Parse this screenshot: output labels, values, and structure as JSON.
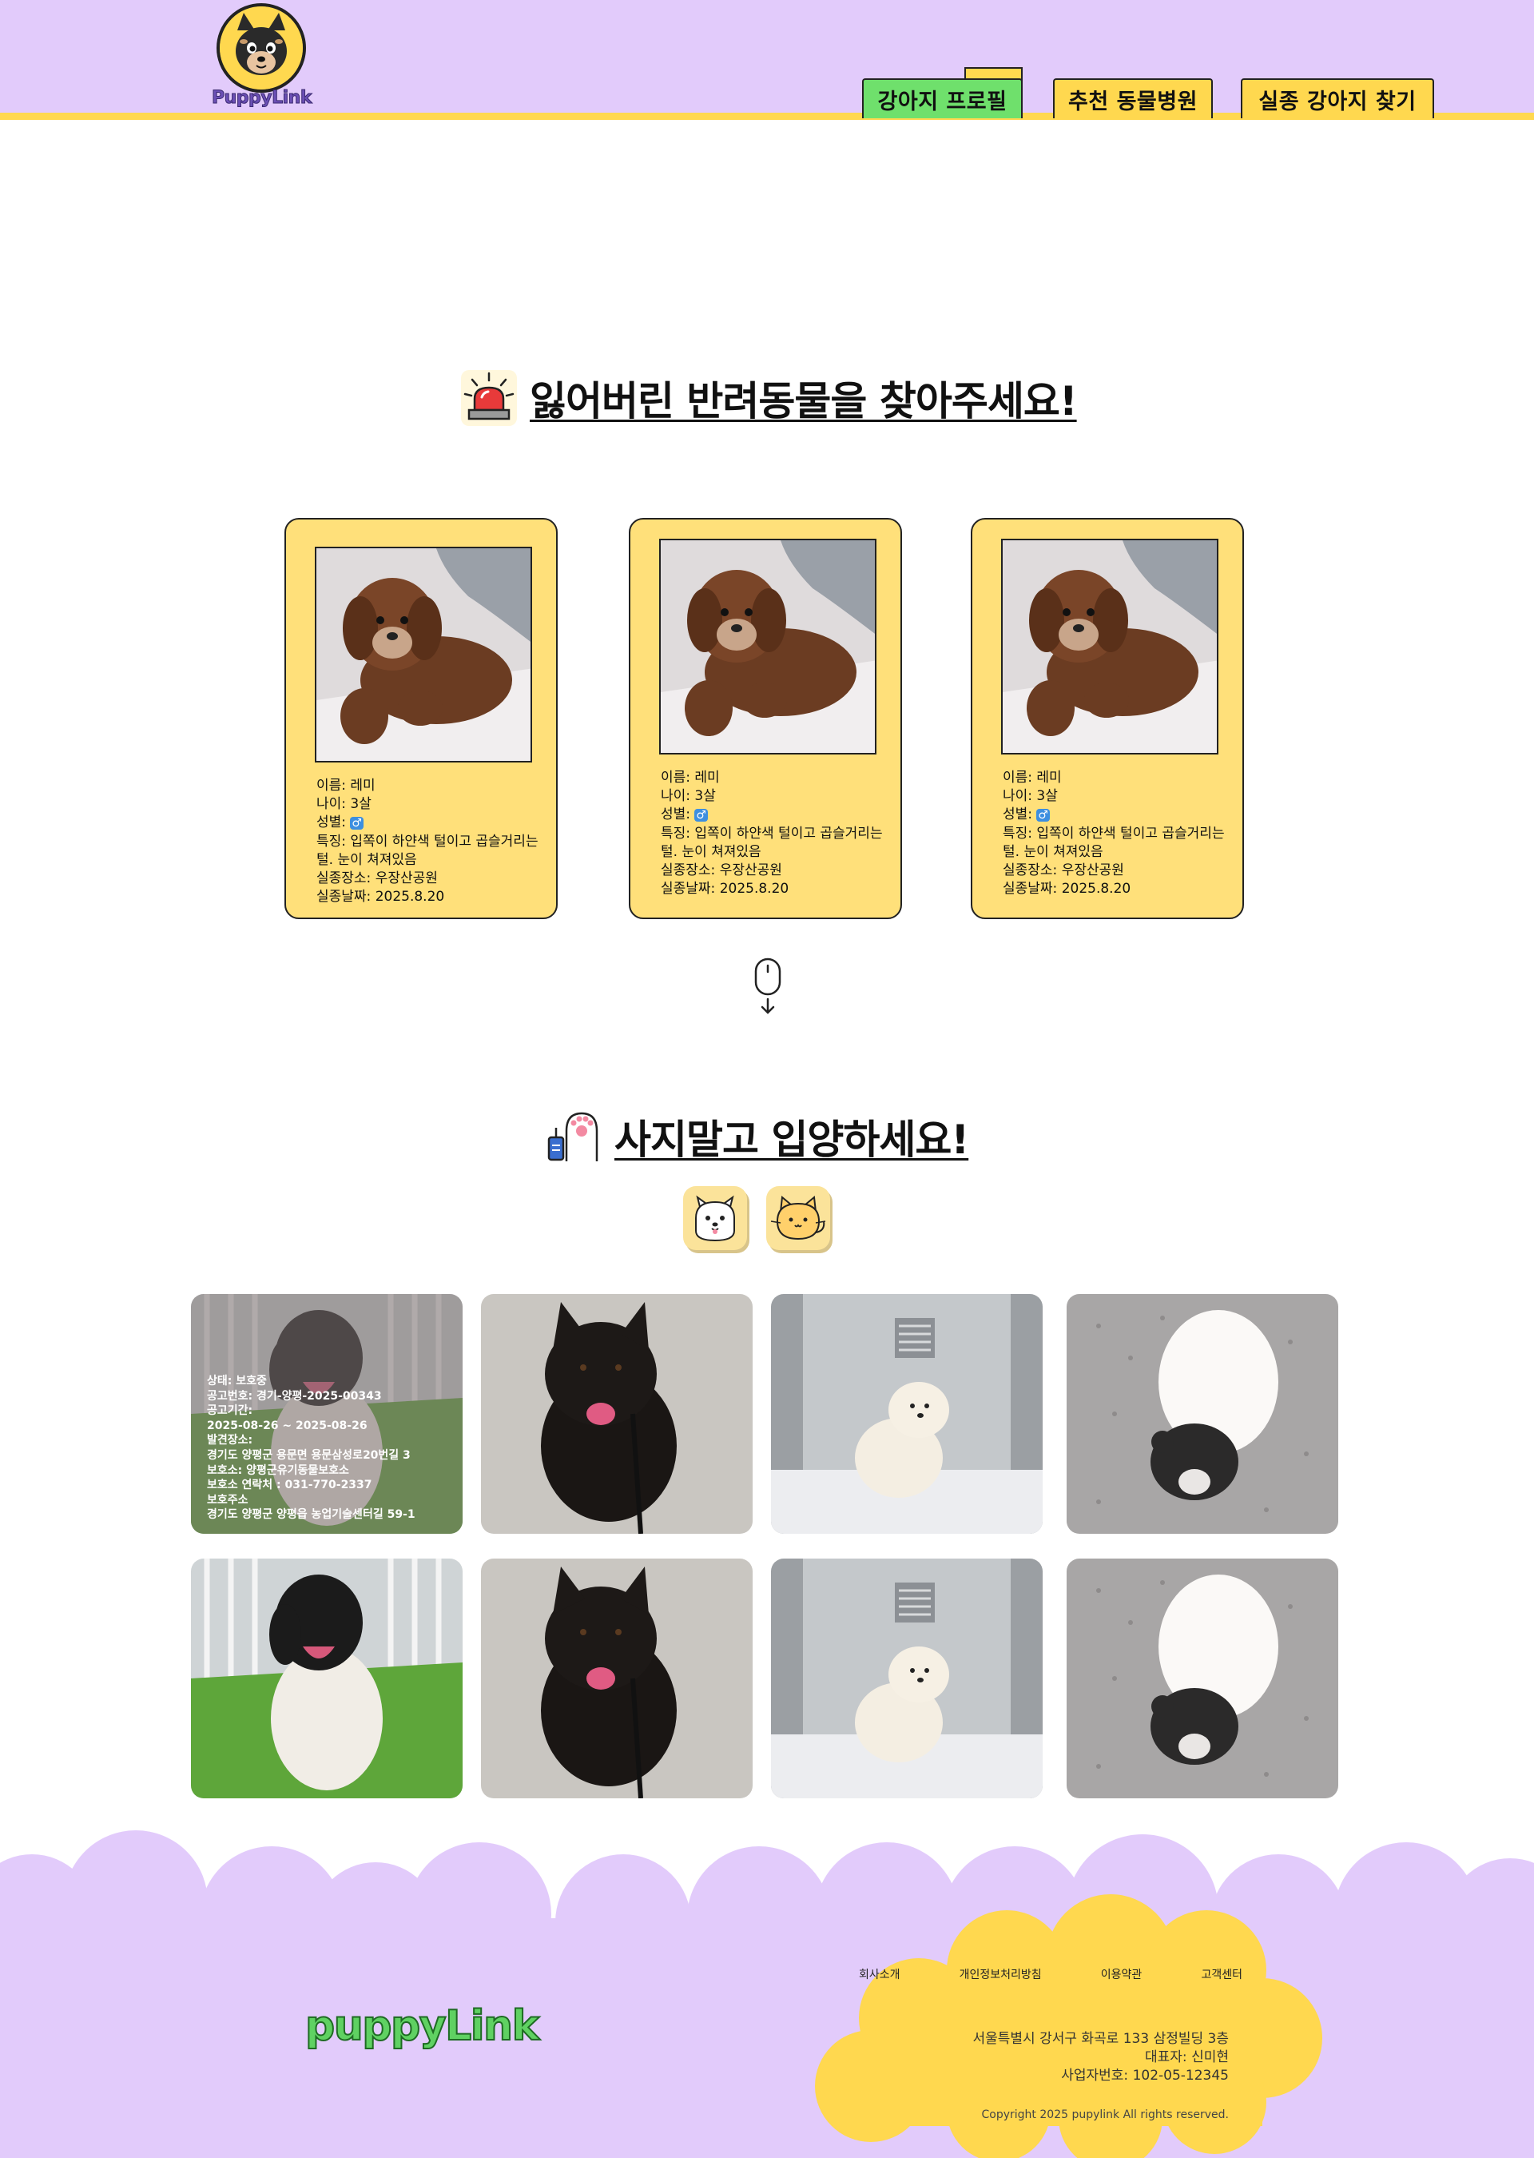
{
  "header": {
    "brand": "PuppyLink",
    "nav": [
      {
        "label": "강아지 프로필"
      },
      {
        "label": "추천 동물병원"
      },
      {
        "label": "실종 강아지 찾기"
      }
    ]
  },
  "missing": {
    "title": "잃어버린 반려동물을 찾아주세요!",
    "cards": [
      {
        "name": "이름: 레미",
        "age": "나이: 3살",
        "gender_label": "성별: ",
        "gender_symbol": "♂",
        "feature": "특징: 입쪽이 하얀색 털이고 곱슬거리는 털. 눈이 쳐져있음",
        "place": "실종장소: 우장산공원",
        "date": "실종날짜: 2025.8.20"
      },
      {
        "name": "이름: 레미",
        "age": "나이: 3살",
        "gender_label": "성별: ",
        "gender_symbol": "♂",
        "feature": "특징: 입쪽이 하얀색 털이고 곱슬거리는 털. 눈이 쳐져있음",
        "place": "실종장소: 우장산공원",
        "date": "실종날짜: 2025.8.20"
      },
      {
        "name": "이름: 레미",
        "age": "나이: 3살",
        "gender_label": "성별: ",
        "gender_symbol": "♂",
        "feature": "특징: 입쪽이 하얀색 털이고 곱슬거리는 털. 눈이 쳐져있음",
        "place": "실종장소: 우장산공원",
        "date": "실종날짜: 2025.8.20"
      }
    ]
  },
  "adopt": {
    "title": "사지말고 입양하세요!",
    "hover_details": [
      "상태: 보호중",
      "공고번호: 경기-양평-2025-00343",
      "공고기간:",
      "2025-08-26 ~ 2025-08-26",
      "발견장소:",
      "경기도 양평군 용문면 용문삼성로20번길 3",
      "보호소: 양평군유기동물보호소",
      "보호소 연락처 : 031-770-2337",
      "보호주소",
      "경기도 양평군 양평읍 농업기술센터길 59-1"
    ]
  },
  "footer": {
    "logo": "puppyLink",
    "links": [
      "회사소개",
      "개인정보처리방침",
      "이용약관",
      "고객센터"
    ],
    "address": "서울특별시 강서구 화곡로 133 삼정빌딩 3층",
    "ceo": "대표자: 신미현",
    "biz_no": "사업자번호: 102-05-12345",
    "copyright": "Copyright 2025 pupylink All rights reserved."
  },
  "colors": {
    "header_bg": "#e2cbfb",
    "accent_yellow": "#ffd84f",
    "accent_green": "#6fe06c",
    "card_bg": "#ffe07a"
  }
}
